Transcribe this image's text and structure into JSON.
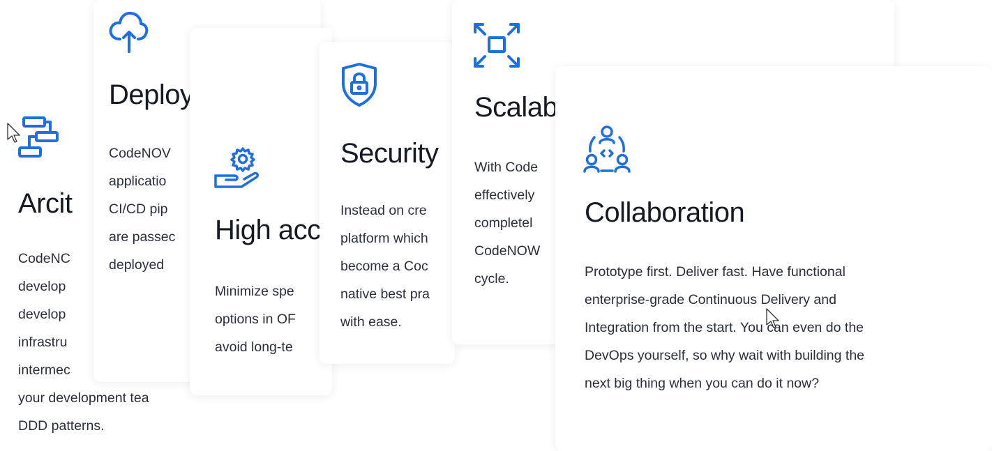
{
  "cards": {
    "architecture": {
      "title": "Arcit",
      "icon": "architecture-blocks-icon",
      "text": "CodeNC\ndevelop\ndevelop\ninfrastru\nintermec\nyour development tea\nDDD patterns."
    },
    "deployment": {
      "title": "Deployment",
      "icon": "cloud-upload-icon",
      "text": "CodeNOV\napplicatio\nCI/CD pip\nare passec\ndeployed"
    },
    "high_availability": {
      "title": "High acc",
      "icon": "hand-gear-icon",
      "text": "Minimize spe\noptions in OF\navoid long-te"
    },
    "security": {
      "title": "Security",
      "icon": "shield-lock-icon",
      "text": "Instead on cre\nplatform which\nbecome a Coc\nnative best pra\nwith ease."
    },
    "scalability": {
      "title": "Scalab",
      "icon": "expand-arrows-icon",
      "text": "With Code\neffectively\ncompletel\nCodeNOW\ncycle."
    },
    "collaboration": {
      "title": "Collaboration",
      "icon": "team-code-icon",
      "text": "Prototype first. Deliver fast. Have functional\nenterprise-grade Continuous Delivery and\nIntegration from the start. You can even do the\nDevOps yourself, so why wait with building the\nnext big thing when you can do it now?"
    }
  },
  "colors": {
    "accent": "#1f6fe0",
    "title": "#161a22",
    "body": "#2a2f3a"
  }
}
